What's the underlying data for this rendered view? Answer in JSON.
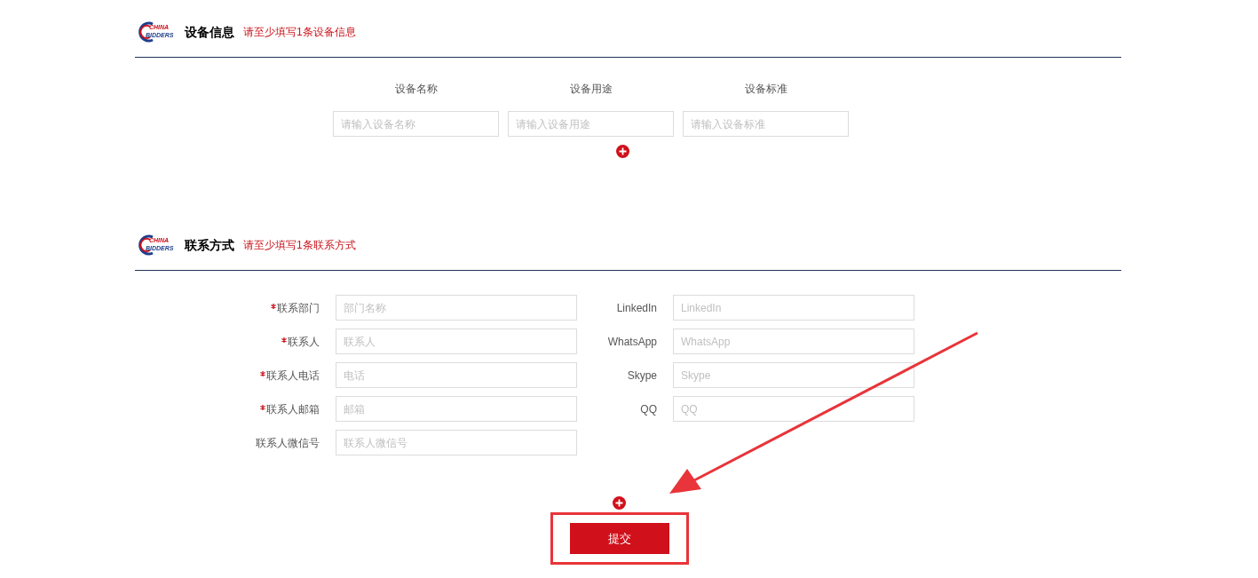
{
  "device_section": {
    "logo": [
      "CHINA",
      "BIDDERS"
    ],
    "title": "设备信息",
    "hint": "请至少填写1条设备信息",
    "columns": [
      {
        "label": "设备名称",
        "placeholder": "请输入设备名称"
      },
      {
        "label": "设备用途",
        "placeholder": "请输入设备用途"
      },
      {
        "label": "设备标准",
        "placeholder": "请输入设备标准"
      }
    ]
  },
  "contact_section": {
    "logo": [
      "CHINA",
      "BIDDERS"
    ],
    "title": "联系方式",
    "hint": "请至少填写1条联系方式",
    "left_fields": [
      {
        "label": "联系部门",
        "placeholder": "部门名称",
        "required": true
      },
      {
        "label": "联系人",
        "placeholder": "联系人",
        "required": true
      },
      {
        "label": "联系人电话",
        "placeholder": "电话",
        "required": true
      },
      {
        "label": "联系人邮箱",
        "placeholder": "邮箱",
        "required": true
      },
      {
        "label": "联系人微信号",
        "placeholder": "联系人微信号",
        "required": false
      }
    ],
    "right_fields": [
      {
        "label": "LinkedIn",
        "placeholder": "LinkedIn",
        "required": false
      },
      {
        "label": "WhatsApp",
        "placeholder": "WhatsApp",
        "required": false
      },
      {
        "label": "Skype",
        "placeholder": "Skype",
        "required": false
      },
      {
        "label": "QQ",
        "placeholder": "QQ",
        "required": false
      }
    ]
  },
  "submit_button": "提交"
}
